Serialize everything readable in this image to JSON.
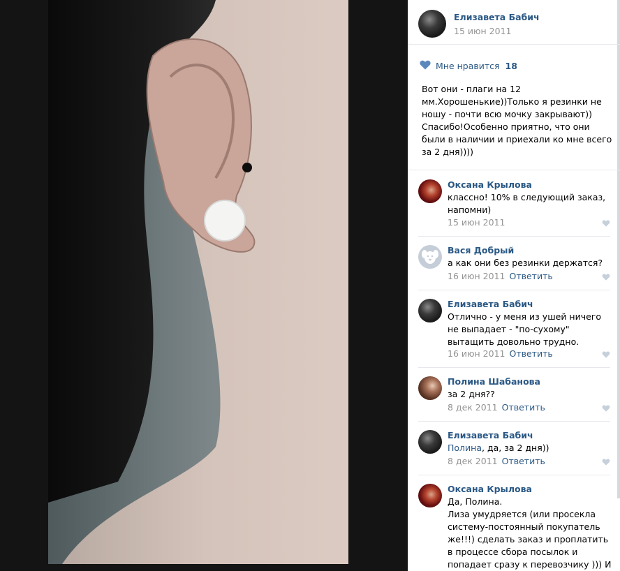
{
  "author": {
    "name": "Елизавета Бабич",
    "date": "15 июн 2011"
  },
  "likes": {
    "label": "Мне нравится",
    "count": "18"
  },
  "post": {
    "text": "Вот они - плаги на 12 мм.Хорошенькие))Только я резинки не ношу - почти всю мочку закрывают)) Спасибо!Особенно приятно, что они были в наличии и приехали ко мне всего за 2 дня))))"
  },
  "comments": [
    {
      "author": "Оксана Крылова",
      "text": "классно! 10% в следующий заказ, напомни)",
      "date": "15 июн 2011",
      "reply": ""
    },
    {
      "author": "Вася Добрый",
      "text": "а как они без резинки держатся?",
      "date": "16 июн 2011",
      "reply": "Ответить"
    },
    {
      "author": "Елизавета Бабич",
      "text": "Отлично - у меня из ушей ничего не выпадает - \"по-сухому\" вытащить довольно трудно.",
      "date": "16 июн 2011",
      "reply": "Ответить"
    },
    {
      "author": "Полина Шабанова",
      "text": "за 2 дня??",
      "date": "8 дек 2011",
      "reply": "Ответить"
    },
    {
      "author": "Елизавета Бабич",
      "mention": "Полина",
      "text": ", да, за 2 дня))",
      "date": "8 дек 2011",
      "reply": "Ответить"
    },
    {
      "author": "Оксана Крылова",
      "text": "Да, Полина.\nЛиза умудряется (или просекла систему-постоянный покупатель же!!!) сделать заказ и проплатить в процессе сбора посылок и попадает сразу к перевозчику ))) И перевозчик",
      "date": "",
      "reply": ""
    }
  ],
  "colors": {
    "link": "#2a5885",
    "muted": "#939393",
    "heart": "#5b88bd",
    "heart_small": "#c5d0db"
  }
}
